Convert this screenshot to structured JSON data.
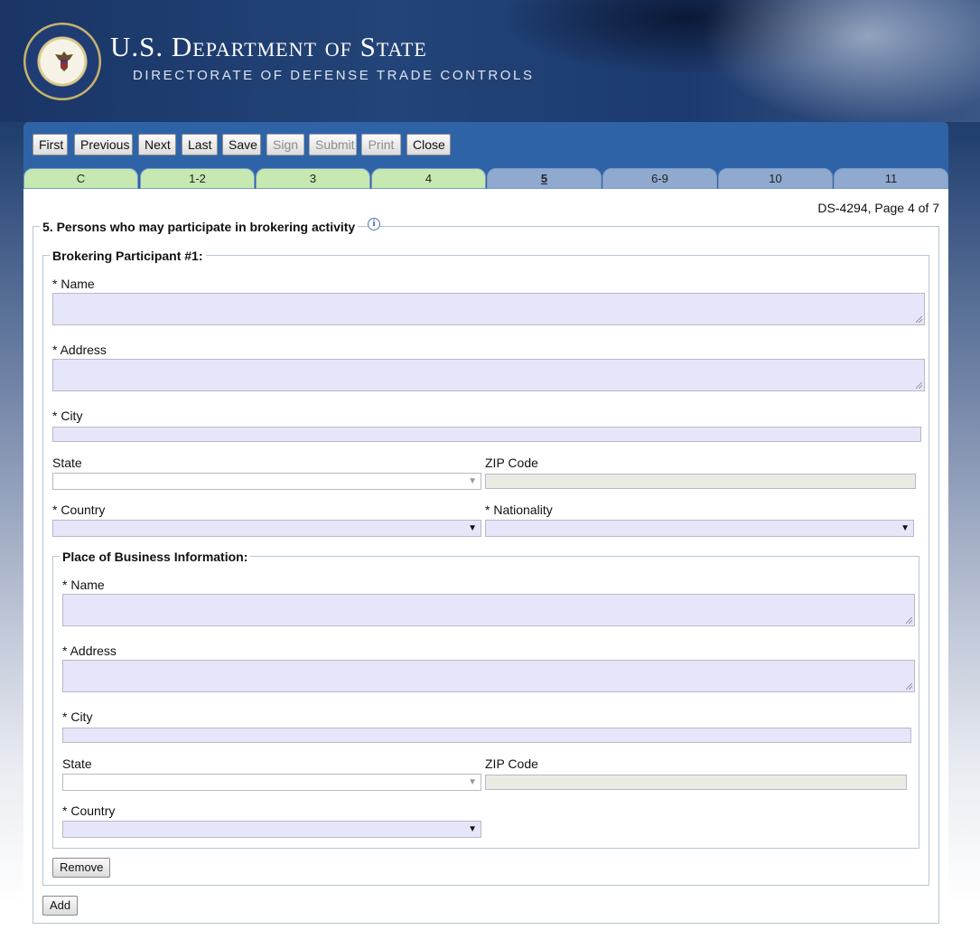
{
  "header": {
    "title_main": "U.S. D",
    "title_a": "EPARTMENT",
    "title_of": "OF",
    "title_b": "S",
    "title_c": "TATE",
    "subtitle": "DIRECTORATE OF DEFENSE TRADE CONTROLS"
  },
  "toolbar": {
    "buttons": [
      "First",
      "Previous",
      "Next",
      "Last",
      "Save",
      "Sign",
      "Submit",
      "Print",
      "Close"
    ]
  },
  "tabs": [
    "C",
    "1-2",
    "3",
    "4",
    "5",
    "6-9",
    "10",
    "11"
  ],
  "page_info": "DS-4294, Page 4 of 7",
  "section": {
    "title": "5. Persons who may participate in brokering activity",
    "participant_title": "Brokering Participant #1:",
    "name_label": "* Name",
    "address_label": "* Address",
    "city_label": "* City",
    "state_label": "State",
    "zip_label": "ZIP Code",
    "country_label": "* Country",
    "nationality_label": "* Nationality",
    "business": {
      "title": "Place of Business Information:",
      "name_label": "* Name",
      "address_label": "* Address",
      "city_label": "* City",
      "state_label": "State",
      "zip_label": "ZIP Code",
      "country_label": "* Country"
    },
    "remove_label": "Remove",
    "add_label": "Add"
  }
}
